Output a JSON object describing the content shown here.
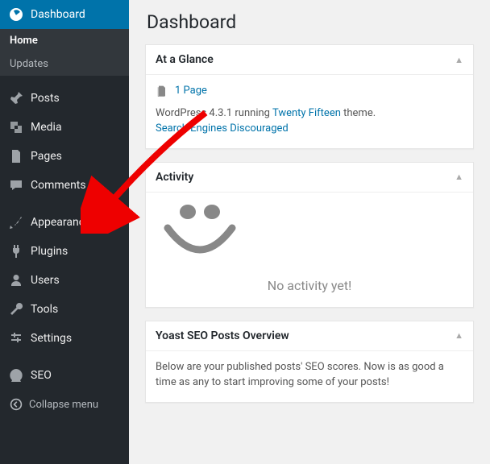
{
  "page": {
    "title": "Dashboard"
  },
  "sidebar": {
    "dashboard": "Dashboard",
    "home": "Home",
    "updates": "Updates",
    "posts": "Posts",
    "media": "Media",
    "pages": "Pages",
    "comments": "Comments",
    "appearance": "Appearance",
    "plugins": "Plugins",
    "users": "Users",
    "tools": "Tools",
    "settings": "Settings",
    "seo": "SEO",
    "collapse": "Collapse menu"
  },
  "glance": {
    "title": "At a Glance",
    "pages_link": "1 Page",
    "version_prefix": "WordPress 4.3.1 running ",
    "theme": "Twenty Fifteen",
    "version_suffix": " theme.",
    "discouraged": "Search Engines Discouraged"
  },
  "activity": {
    "title": "Activity",
    "empty": "No activity yet!"
  },
  "yoast": {
    "title": "Yoast SEO Posts Overview",
    "body": "Below are your published posts' SEO scores. Now is as good a time as any to start improving some of your posts!"
  }
}
